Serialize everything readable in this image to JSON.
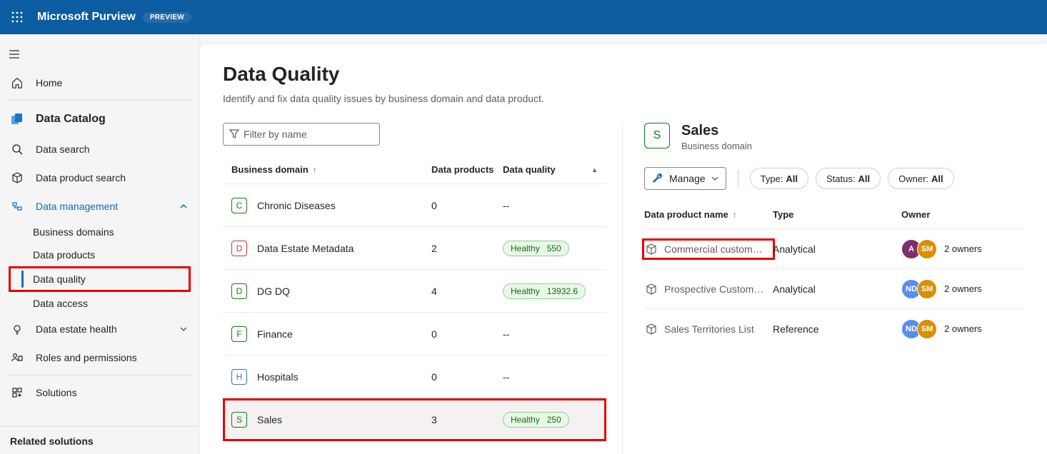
{
  "header": {
    "brand": "Microsoft Purview",
    "badge": "PREVIEW"
  },
  "sidebar": {
    "home": "Home",
    "catalog_heading": "Data Catalog",
    "items": {
      "search": "Data search",
      "product_search": "Data product search",
      "management": "Data management",
      "health": "Data estate health",
      "roles": "Roles and permissions",
      "solutions": "Solutions"
    },
    "mgmt_children": {
      "domains": "Business domains",
      "products": "Data products",
      "quality": "Data quality",
      "access": "Data access"
    },
    "related": "Related solutions"
  },
  "page": {
    "title": "Data Quality",
    "subtitle": "Identify and fix data quality issues by business domain and data product.",
    "filter_placeholder": "Filter by name"
  },
  "table": {
    "headers": {
      "bd": "Business domain",
      "dp": "Data products",
      "dq": "Data quality"
    },
    "rows": [
      {
        "letter": "C",
        "chip": "chip-green",
        "name": "Chronic Diseases",
        "dp": "0",
        "dq_label": "--",
        "pill": false
      },
      {
        "letter": "D",
        "chip": "chip-red",
        "name": "Data Estate Metadata",
        "dp": "2",
        "dq_label": "Healthy",
        "dq_value": "550",
        "pill": true
      },
      {
        "letter": "D",
        "chip": "chip-green",
        "name": "DG DQ",
        "dp": "4",
        "dq_label": "Healthy",
        "dq_value": "13932.6",
        "pill": true
      },
      {
        "letter": "F",
        "chip": "chip-green",
        "name": "Finance",
        "dp": "0",
        "dq_label": "--",
        "pill": false
      },
      {
        "letter": "H",
        "chip": "chip-blue",
        "name": "Hospitals",
        "dp": "0",
        "dq_label": "--",
        "pill": false
      },
      {
        "letter": "S",
        "chip": "chip-green",
        "name": "Sales",
        "dp": "3",
        "dq_label": "Healthy",
        "dq_value": "250",
        "pill": true,
        "selected": true,
        "highlight": true
      }
    ],
    "empty_dq": "--"
  },
  "detail": {
    "chip_letter": "S",
    "title": "Sales",
    "subtitle": "Business domain",
    "manage": "Manage",
    "filters": {
      "type_label": "Type:",
      "type_val": "All",
      "status_label": "Status:",
      "status_val": "All",
      "owner_label": "Owner:",
      "owner_val": "All"
    },
    "headers": {
      "name": "Data product name",
      "type": "Type",
      "owner": "Owner"
    },
    "rows": [
      {
        "name": "Commercial custom…",
        "type": "Analytical",
        "avatars": [
          {
            "t": "A",
            "c": "av-purple"
          },
          {
            "t": "SM",
            "c": "av-orange"
          }
        ],
        "owners": "2 owners",
        "highlight": true
      },
      {
        "name": "Prospective Custom…",
        "type": "Analytical",
        "avatars": [
          {
            "t": "ND",
            "c": "av-blue"
          },
          {
            "t": "SM",
            "c": "av-orange"
          }
        ],
        "owners": "2 owners"
      },
      {
        "name": "Sales Territories List",
        "type": "Reference",
        "avatars": [
          {
            "t": "ND",
            "c": "av-blue"
          },
          {
            "t": "SM",
            "c": "av-orange"
          }
        ],
        "owners": "2 owners"
      }
    ]
  }
}
